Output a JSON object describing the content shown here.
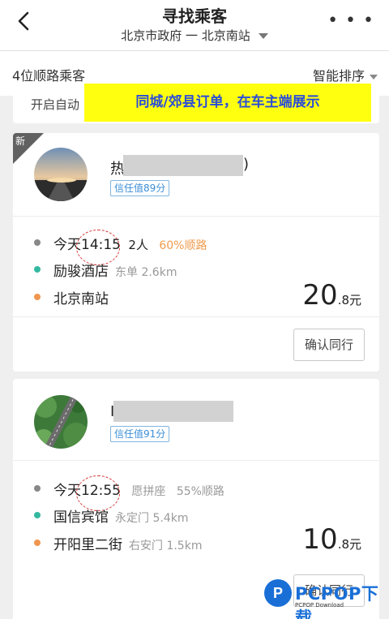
{
  "header": {
    "title": "寻找乘客",
    "route": "北京市政府 一 北京南站"
  },
  "filter": {
    "count_label": "4位顺路乘客",
    "sort_label": "智能排序"
  },
  "peek_text": "开启自动",
  "banner": {
    "text": "同城/郊县订单，在车主端展示",
    "bg_color": "#ffff10",
    "text_color": "#2b4dd6"
  },
  "cards": [
    {
      "tag": "新",
      "name_prefix": "热",
      "name_suffix": ")",
      "trust": "信任值89分",
      "day": "今天",
      "time": "14:15",
      "passengers": "2人",
      "match": "60%顺路",
      "origin": "励骏酒店",
      "origin_detail": "东单 2.6km",
      "destination": "北京南站",
      "destination_detail": "",
      "price_main": "20",
      "price_unit": ".8元",
      "button": "确认同行"
    },
    {
      "name_prefix": "I",
      "trust": "信任值91分",
      "day": "今天",
      "time": "12:55",
      "passengers": "愿拼座",
      "match": "55%顺路",
      "origin": "国信宾馆",
      "origin_detail": "永定门 5.4km",
      "destination": "开阳里二街",
      "destination_detail": "右安门 1.5km",
      "price_main": "10",
      "price_unit": ".8元",
      "button": "确认同行"
    }
  ],
  "watermark": {
    "brand": "PCPOP下载",
    "sub": "PCPOP Download"
  }
}
